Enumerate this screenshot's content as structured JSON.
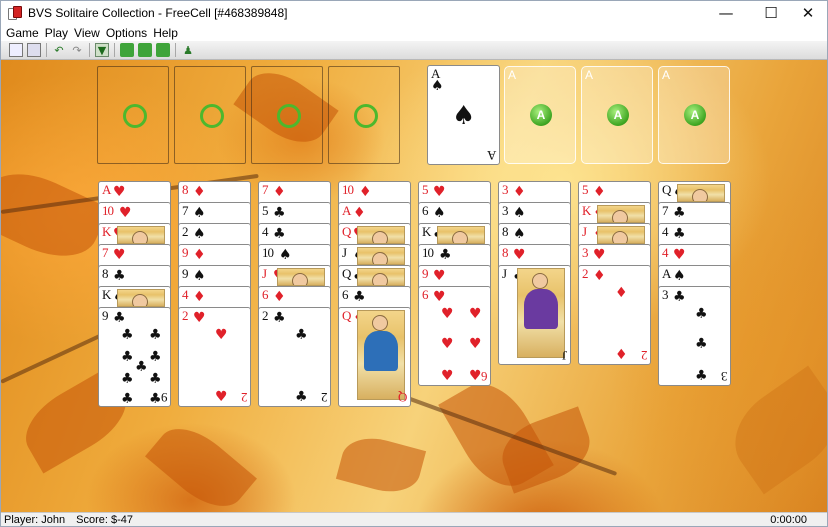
{
  "window": {
    "title": "BVS Solitaire Collection  -  FreeCell [#468389848]",
    "minimize": "—",
    "maximize": "☐",
    "close": "✕"
  },
  "menu": [
    "Game",
    "Play",
    "View",
    "Options",
    "Help"
  ],
  "toolbar": [
    "new-game-icon",
    "statistics-icon",
    "undo-icon",
    "redo-icon",
    "deal-icon",
    "hint-icon",
    "autoplay-icon",
    "help-icon",
    "player-icon"
  ],
  "foundations": [
    {
      "rank": "A",
      "suit": "♠",
      "color": "black",
      "filled": true
    },
    {
      "rank": "A",
      "filled": false
    },
    {
      "rank": "A",
      "filled": false
    },
    {
      "rank": "A",
      "filled": false
    }
  ],
  "foundation_gem": "A",
  "columns": [
    [
      {
        "r": "A",
        "s": "♥"
      },
      {
        "r": "10",
        "s": "♥"
      },
      {
        "r": "K",
        "s": "♥"
      },
      {
        "r": "7",
        "s": "♥"
      },
      {
        "r": "8",
        "s": "♣"
      },
      {
        "r": "K",
        "s": "♠"
      },
      {
        "r": "9",
        "s": "♣"
      }
    ],
    [
      {
        "r": "8",
        "s": "♦"
      },
      {
        "r": "7",
        "s": "♠"
      },
      {
        "r": "2",
        "s": "♠"
      },
      {
        "r": "9",
        "s": "♦"
      },
      {
        "r": "9",
        "s": "♠"
      },
      {
        "r": "4",
        "s": "♦"
      },
      {
        "r": "2",
        "s": "♥"
      }
    ],
    [
      {
        "r": "7",
        "s": "♦"
      },
      {
        "r": "5",
        "s": "♣"
      },
      {
        "r": "4",
        "s": "♣"
      },
      {
        "r": "10",
        "s": "♠"
      },
      {
        "r": "J",
        "s": "♥"
      },
      {
        "r": "6",
        "s": "♦"
      },
      {
        "r": "2",
        "s": "♣"
      }
    ],
    [
      {
        "r": "10",
        "s": "♦"
      },
      {
        "r": "A",
        "s": "♦"
      },
      {
        "r": "Q",
        "s": "♥"
      },
      {
        "r": "J",
        "s": "♠"
      },
      {
        "r": "Q",
        "s": "♣"
      },
      {
        "r": "6",
        "s": "♣"
      },
      {
        "r": "Q",
        "s": "♦"
      }
    ],
    [
      {
        "r": "5",
        "s": "♥"
      },
      {
        "r": "6",
        "s": "♠"
      },
      {
        "r": "K",
        "s": "♣"
      },
      {
        "r": "10",
        "s": "♣"
      },
      {
        "r": "9",
        "s": "♥"
      },
      {
        "r": "6",
        "s": "♥"
      }
    ],
    [
      {
        "r": "3",
        "s": "♦"
      },
      {
        "r": "3",
        "s": "♠"
      },
      {
        "r": "8",
        "s": "♠"
      },
      {
        "r": "8",
        "s": "♥"
      },
      {
        "r": "J",
        "s": "♣"
      }
    ],
    [
      {
        "r": "5",
        "s": "♦"
      },
      {
        "r": "K",
        "s": "♦"
      },
      {
        "r": "J",
        "s": "♦"
      },
      {
        "r": "3",
        "s": "♥"
      },
      {
        "r": "2",
        "s": "♦"
      }
    ],
    [
      {
        "r": "Q",
        "s": "♠"
      },
      {
        "r": "7",
        "s": "♣"
      },
      {
        "r": "4",
        "s": "♣"
      },
      {
        "r": "4",
        "s": "♥"
      },
      {
        "r": "A",
        "s": "♠"
      },
      {
        "r": "3",
        "s": "♣"
      }
    ]
  ],
  "status": {
    "player": "Player: John",
    "score": "Score: $-47",
    "time": "0:00:00"
  }
}
